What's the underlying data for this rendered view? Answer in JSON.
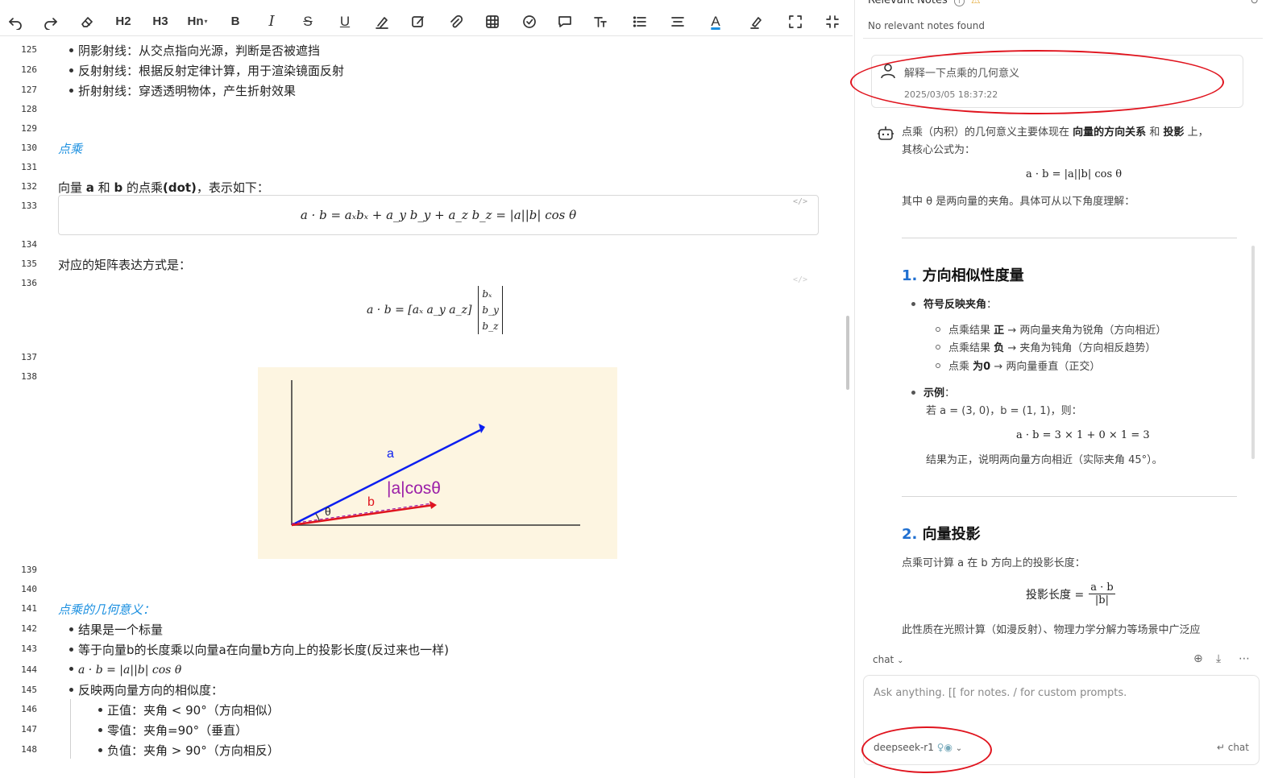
{
  "toolbar": {
    "h2": "H2",
    "h3": "H3",
    "hn": "Hn",
    "bold": "B",
    "italic": "I",
    "strike": "S",
    "underline": "U",
    "text_color": "A"
  },
  "editor": {
    "line_numbers": [
      "125",
      "126",
      "127",
      "128",
      "129",
      "130",
      "131",
      "132",
      "133",
      "134",
      "135",
      "136",
      "137",
      "138",
      "139",
      "140",
      "141",
      "142",
      "143",
      "144",
      "145",
      "146",
      "147",
      "148"
    ],
    "bullets_top": [
      "阴影射线：从交点指向光源，判断是否被遮挡",
      "反射射线：根据反射定律计算，用于渲染镜面反射",
      "折射射线：穿透透明物体，产生折射效果"
    ],
    "heading_dot": "点乘",
    "line132_prefix": "向量 ",
    "line132_a": "a",
    "line132_and": " 和 ",
    "line132_b": "b",
    "line132_mid": " 的点乘",
    "line132_dot": "(dot)",
    "line132_suffix": "，表示如下：",
    "formula_dot": "a · b = aₓbₓ + a_y b_y + a_z b_z = |a||b| cos θ",
    "code_tag": "</>",
    "matrix_intro": "对应的矩阵表达方式是：",
    "matrix_lhs": "a · b = [aₓ   a_y   a_z]",
    "matrix_col": [
      "bₓ",
      "b_y",
      "b_z"
    ],
    "diagram": {
      "label_a": "a",
      "label_b": "b",
      "label_theta": "θ",
      "label_proj": "|a|cosθ",
      "bg": "#fdf5e1"
    },
    "heading_geo": "点乘的几何意义：",
    "bullets_geo": [
      "结果是一个标量",
      "等于向量b的长度乘以向量a在向量b方向上的投影长度(反过来也一样)",
      "a · b = |a||b| cos θ",
      "反映两向量方向的相似度："
    ],
    "sub_bullets": [
      "正值：夹角 < 90°（方向相似）",
      "零值：夹角=90°（垂直）",
      "负值：夹角 > 90°（方向相反）"
    ]
  },
  "panel": {
    "relevant_notes_title": "Relevant Notes",
    "no_notes": "No relevant notes found",
    "user_message": "解释一下点乘的几何意义",
    "user_time": "2025/03/05 18:37:22",
    "ai_intro_1": "点乘（内积）的几何意义主要体现在",
    "ai_intro_b1": "向量的方向关系",
    "ai_intro_and": "和",
    "ai_intro_b2": "投影",
    "ai_intro_end": "上，",
    "ai_intro_2": "其核心公式为：",
    "ai_formula": "a · b = |a||b| cos θ",
    "ai_where": "其中 θ 是两向量的夹角。具体可从以下角度理解：",
    "sec1_num": "1.",
    "sec1_title": "方向相似性度量",
    "sec1_b1": "符号反映夹角",
    "sec1_sub": [
      {
        "pre": "点乘结果",
        "bold": "正",
        "post": "→ 两向量夹角为锐角（方向相近）"
      },
      {
        "pre": "点乘结果",
        "bold": "负",
        "post": "→ 夹角为钝角（方向相反趋势）"
      },
      {
        "pre": "点乘",
        "bold": "为0",
        "post": "→ 两向量垂直（正交）"
      }
    ],
    "sec1_b2": "示例",
    "example_line": "若 a = (3, 0)，b = (1, 1)，则：",
    "example_formula": "a · b = 3 × 1 + 0 × 1 = 3",
    "example_result": "结果为正，说明两向量方向相近（实际夹角 45°）。",
    "sec2_num": "2.",
    "sec2_title": "向量投影",
    "sec2_text": "点乘可计算 a 在 b 方向上的投影长度：",
    "proj_label": "投影长度 =",
    "proj_num": "a · b",
    "proj_den": "|b|",
    "sec2_more": "此性质在光照计算（如漫反射）、物理力学分解力等场景中广泛应",
    "chat_mode": "chat",
    "input_placeholder": "Ask anything. [[ for notes. / for custom prompts.",
    "model": "deepseek-r1",
    "send": "↵ chat"
  },
  "colors": {
    "accent": "#1a8fe0",
    "annotation": "#e0141e",
    "vec_a": "#0b1ef0",
    "vec_b": "#e0141e",
    "proj": "#9b1fa8"
  }
}
